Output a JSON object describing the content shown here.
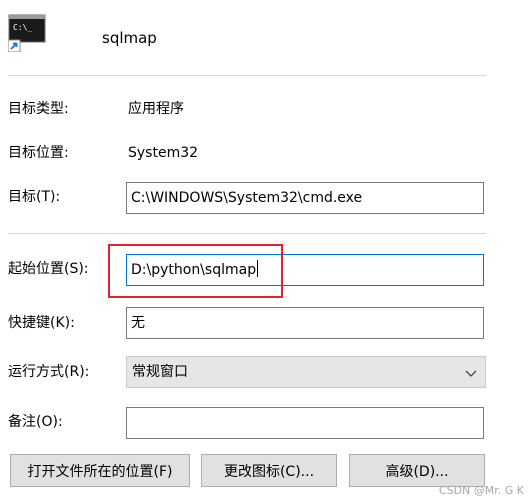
{
  "header": {
    "icon": "cmd-shortcut-icon",
    "name": "sqlmap"
  },
  "fields": {
    "target_type_label": "目标类型:",
    "target_type_value": "应用程序",
    "target_location_label": "目标位置:",
    "target_location_value": "System32",
    "target_label": "目标(T):",
    "target_value": "C:\\WINDOWS\\System32\\cmd.exe",
    "start_in_label": "起始位置(S):",
    "start_in_value": "D:\\python\\sqlmap",
    "shortcut_key_label": "快捷键(K):",
    "shortcut_key_value": "无",
    "run_label": "运行方式(R):",
    "run_value": "常规窗口",
    "comment_label": "备注(O):",
    "comment_value": ""
  },
  "buttons": {
    "open_location": "打开文件所在的位置(F)",
    "change_icon": "更改图标(C)...",
    "advanced": "高级(D)..."
  },
  "watermark": "CSDN @Mr. G K",
  "colors": {
    "highlight": "#e0242e",
    "focus_border": "#0078d7",
    "field_border": "#7a7a7a",
    "button_bg": "#e1e1e1"
  }
}
